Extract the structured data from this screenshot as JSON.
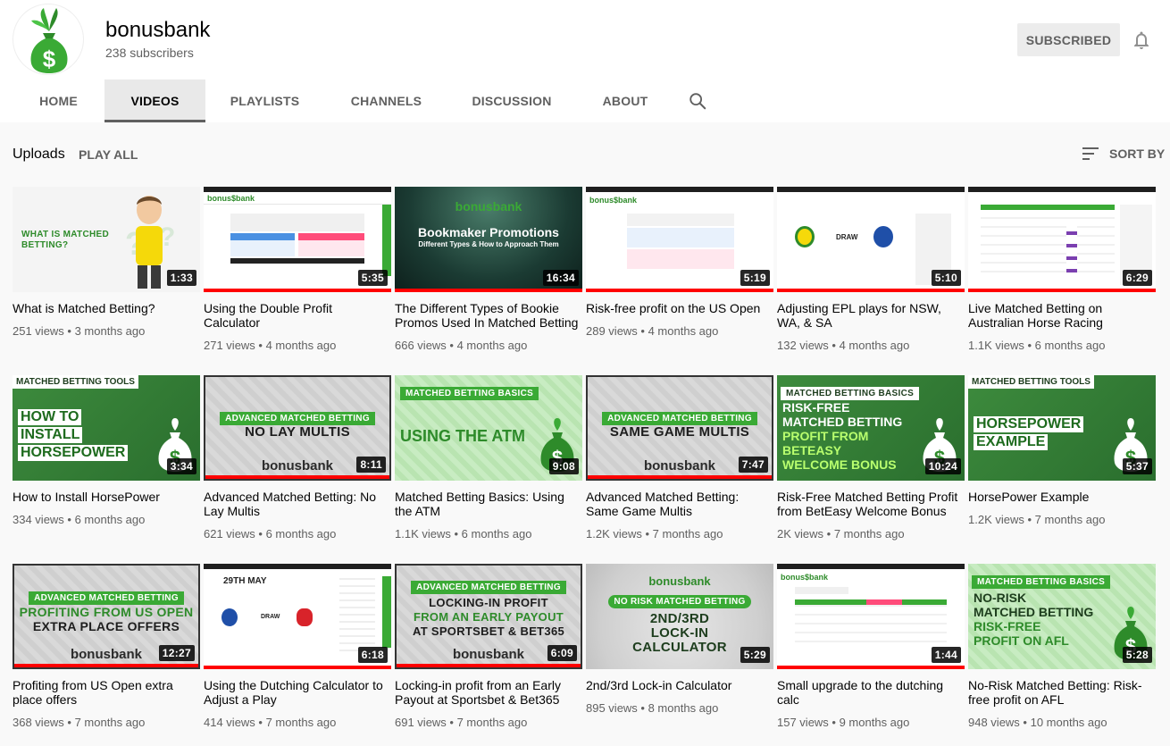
{
  "channel": {
    "name": "bonusbank",
    "subscribers": "238 subscribers",
    "subscribe_label": "SUBSCRIBED",
    "accent": "#3aaa35"
  },
  "tabs": [
    "HOME",
    "VIDEOS",
    "PLAYLISTS",
    "CHANNELS",
    "DISCUSSION",
    "ABOUT"
  ],
  "active_tab": "VIDEOS",
  "uploads": {
    "title": "Uploads",
    "play_all": "PLAY ALL",
    "sort_by": "SORT BY"
  },
  "videos": [
    {
      "title": "What is Matched Betting?",
      "views": "251 views",
      "age": "3 months ago",
      "duration": "1:33",
      "thumb_text": [
        "WHAT IS MATCHED",
        "BETTING?"
      ]
    },
    {
      "title": "Using the Double Profit Calculator",
      "views": "271 views",
      "age": "4 months ago",
      "duration": "5:35"
    },
    {
      "title": "The Different Types of Bookie Promos Used In Matched Betting",
      "views": "666 views",
      "age": "4 months ago",
      "duration": "16:34",
      "thumb_text": [
        "bonusbank",
        "Bookmaker Promotions",
        "Different Types & How to Approach Them"
      ]
    },
    {
      "title": "Risk-free profit on the US Open",
      "views": "289 views",
      "age": "4 months ago",
      "duration": "5:19"
    },
    {
      "title": "Adjusting EPL plays for NSW, WA, & SA",
      "views": "132 views",
      "age": "4 months ago",
      "duration": "5:10",
      "thumb_text": [
        "DRAW"
      ]
    },
    {
      "title": "Live Matched Betting on Australian Horse Racing",
      "views": "1.1K views",
      "age": "6 months ago",
      "duration": "6:29"
    },
    {
      "title": "How to Install HorsePower",
      "views": "334 views",
      "age": "6 months ago",
      "duration": "3:34",
      "thumb_text": [
        "MATCHED BETTING TOOLS",
        "HOW TO",
        "INSTALL",
        "HORSEPOWER"
      ]
    },
    {
      "title": "Advanced Matched Betting: No Lay Multis",
      "views": "621 views",
      "age": "6 months ago",
      "duration": "8:11",
      "thumb_text": [
        "ADVANCED MATCHED BETTING",
        "NO LAY MULTIS",
        "bonusbank"
      ]
    },
    {
      "title": "Matched Betting Basics: Using the ATM",
      "views": "1.1K views",
      "age": "6 months ago",
      "duration": "9:08",
      "thumb_text": [
        "MATCHED BETTING BASICS",
        "USING THE ATM"
      ]
    },
    {
      "title": "Advanced Matched Betting: Same Game Multis",
      "views": "1.2K views",
      "age": "7 months ago",
      "duration": "7:47",
      "thumb_text": [
        "ADVANCED MATCHED BETTING",
        "SAME GAME MULTIS",
        "bonusbank"
      ]
    },
    {
      "title": "Risk-Free Matched Betting Profit from BetEasy Welcome Bonus",
      "views": "2K views",
      "age": "7 months ago",
      "duration": "10:24",
      "thumb_text": [
        "MATCHED BETTING BASICS",
        "RISK-FREE",
        "MATCHED BETTING",
        "PROFIT FROM",
        "BETEASY",
        "WELCOME BONUS"
      ]
    },
    {
      "title": "HorsePower Example",
      "views": "1.2K views",
      "age": "7 months ago",
      "duration": "5:37",
      "thumb_text": [
        "MATCHED BETTING TOOLS",
        "HORSEPOWER",
        "EXAMPLE"
      ]
    },
    {
      "title": "Profiting from US Open extra place offers",
      "views": "368 views",
      "age": "7 months ago",
      "duration": "12:27",
      "thumb_text": [
        "ADVANCED MATCHED BETTING",
        "PROFITING FROM US OPEN",
        "EXTRA PLACE OFFERS",
        "bonusbank"
      ]
    },
    {
      "title": "Using the Dutching Calculator to Adjust a Play",
      "views": "414 views",
      "age": "7 months ago",
      "duration": "6:18",
      "thumb_text": [
        "29TH MAY",
        "DRAW"
      ]
    },
    {
      "title": "Locking-in profit from an Early Payout at Sportsbet & Bet365",
      "views": "691 views",
      "age": "7 months ago",
      "duration": "6:09",
      "thumb_text": [
        "ADVANCED MATCHED BETTING",
        "LOCKING-IN PROFIT",
        "FROM AN EARLY PAYOUT",
        "AT SPORTSBET & BET365",
        "bonusbank"
      ]
    },
    {
      "title": "2nd/3rd Lock-in Calculator",
      "views": "895 views",
      "age": "8 months ago",
      "duration": "5:29",
      "thumb_text": [
        "bonusbank",
        "NO RISK MATCHED BETTING",
        "2ND/3RD",
        "LOCK-IN",
        "CALCULATOR"
      ]
    },
    {
      "title": "Small upgrade to the dutching calc",
      "views": "157 views",
      "age": "9 months ago",
      "duration": "1:44"
    },
    {
      "title": "No-Risk Matched Betting: Risk-free profit on AFL",
      "views": "948 views",
      "age": "10 months ago",
      "duration": "5:28",
      "thumb_text": [
        "MATCHED BETTING BASICS",
        "NO-RISK",
        "MATCHED BETTING",
        "RISK-FREE",
        "PROFIT ON AFL"
      ]
    }
  ]
}
